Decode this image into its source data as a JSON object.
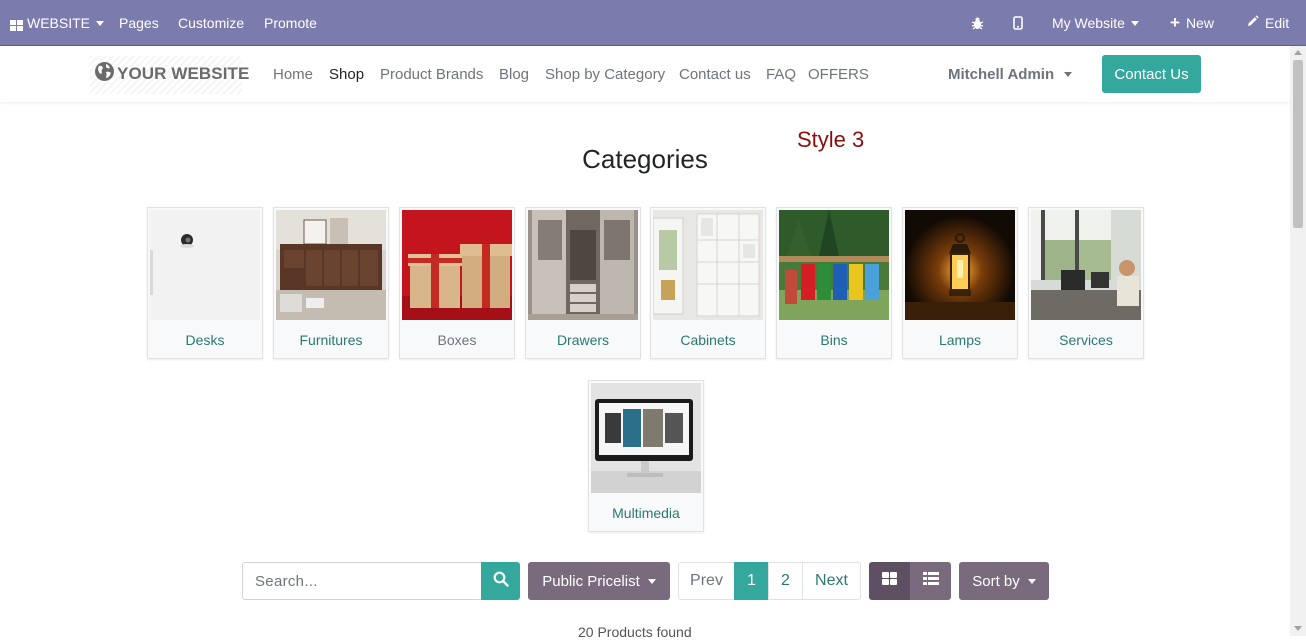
{
  "admin_bar": {
    "app_label": "WEBSITE",
    "menus": [
      "Pages",
      "Customize",
      "Promote"
    ],
    "site_selector": "My Website",
    "new_label": "New",
    "edit_label": "Edit"
  },
  "header": {
    "logo_text": "YOUR WEBSITE",
    "nav": [
      "Home",
      "Shop",
      "Product Brands",
      "Blog",
      "Shop by Category",
      "Contact us",
      "FAQ",
      "OFFERS"
    ],
    "active_nav": "Shop",
    "user": "Mitchell Admin",
    "contact_button": "Contact Us"
  },
  "page": {
    "style_label": "Style 3",
    "title": "Categories",
    "categories": [
      "Desks",
      "Furnitures",
      "Boxes",
      "Drawers",
      "Cabinets",
      "Bins",
      "Lamps",
      "Services",
      "Multimedia"
    ]
  },
  "toolbar": {
    "search_placeholder": "Search...",
    "pricelist": "Public Pricelist",
    "pager": {
      "prev": "Prev",
      "pages": [
        "1",
        "2"
      ],
      "current": "1",
      "next": "Next"
    },
    "sort_by": "Sort by"
  },
  "footer": {
    "products_found": "20 Products found"
  },
  "colors": {
    "admin_bar": "#7c7bad",
    "accent": "#35a89e",
    "secondary": "#7a6a7e",
    "style_label": "#8b0e0e"
  }
}
